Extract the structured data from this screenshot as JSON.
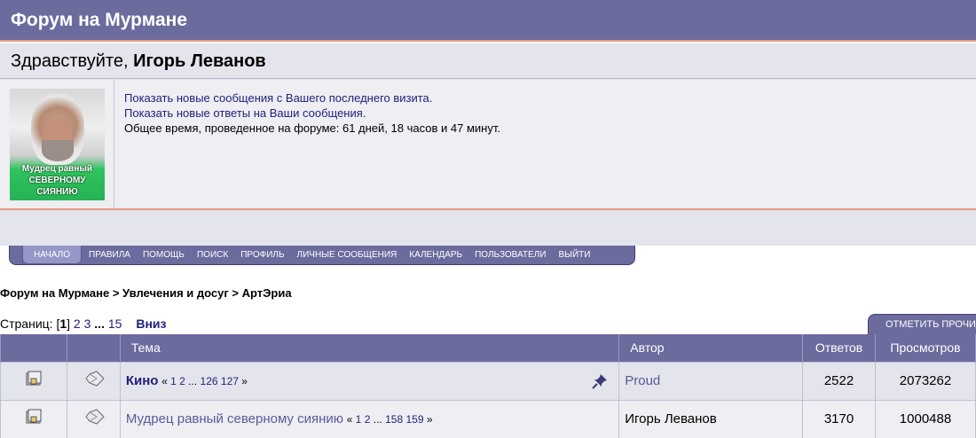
{
  "site": {
    "title": "Форум на Мурмане"
  },
  "welcome": {
    "greeting": "Здравствуйте, ",
    "username": "Игорь Леванов"
  },
  "avatar": {
    "caption": "Мудрец равный СЕВЕРНОМУ СИЯНИЮ"
  },
  "user_links": {
    "new_posts": "Показать новые сообщения с Вашего последнего визита.",
    "new_replies": "Показать новые ответы на Ваши сообщения.",
    "time_spent": "Общее время, проведенное на форуме: 61 дней, 18 часов и 47 минут."
  },
  "nav": {
    "items": [
      "НАЧАЛО",
      "ПРАВИЛА",
      "ПОМОЩЬ",
      "ПОИСК",
      "ПРОФИЛЬ",
      "ЛИЧНЫЕ СООБЩЕНИЯ",
      "КАЛЕНДАРЬ",
      "ПОЛЬЗОВАТЕЛИ",
      "ВЫЙТИ"
    ],
    "active": "НАЧАЛО"
  },
  "breadcrumb": {
    "items": [
      "Форум на Мурмане",
      "Увлечения и досуг",
      "АртЭриа"
    ],
    "separator": ">"
  },
  "pagination": {
    "label": "Страниц:",
    "current": "1",
    "pages": [
      "2",
      "3"
    ],
    "ellipsis": "...",
    "last": "15",
    "down_label": "Вниз"
  },
  "mark_read_button": "ОТМЕТИТЬ ПРОЧИТ",
  "table": {
    "headers": {
      "topic": "Тема",
      "author": "Автор",
      "replies": "Ответов",
      "views": "Просмотров"
    },
    "rows": [
      {
        "title": "Кино",
        "pages_open": "«",
        "p1": "1",
        "p2": "2",
        "ellipsis": "...",
        "p3": "126",
        "p4": "127",
        "pages_close": "»",
        "author": "Proud",
        "replies": "2522",
        "views": "2073262",
        "pinned": true
      },
      {
        "title": "Мудрец равный северному сиянию",
        "pages_open": "«",
        "p1": "1",
        "p2": "2",
        "ellipsis": "...",
        "p3": "158",
        "p4": "159",
        "pages_close": "»",
        "author": "Игорь Леванов",
        "replies": "3170",
        "views": "1000488",
        "pinned": false
      }
    ]
  },
  "colors": {
    "header_bg": "#6b6b9e",
    "accent_line": "#e89a80",
    "panel_bg": "#e4e4ec",
    "link": "#1f1f7a"
  },
  "icons": {
    "folder": "topic-folder-icon",
    "diamond": "topic-type-icon",
    "pin": "pin-icon"
  }
}
